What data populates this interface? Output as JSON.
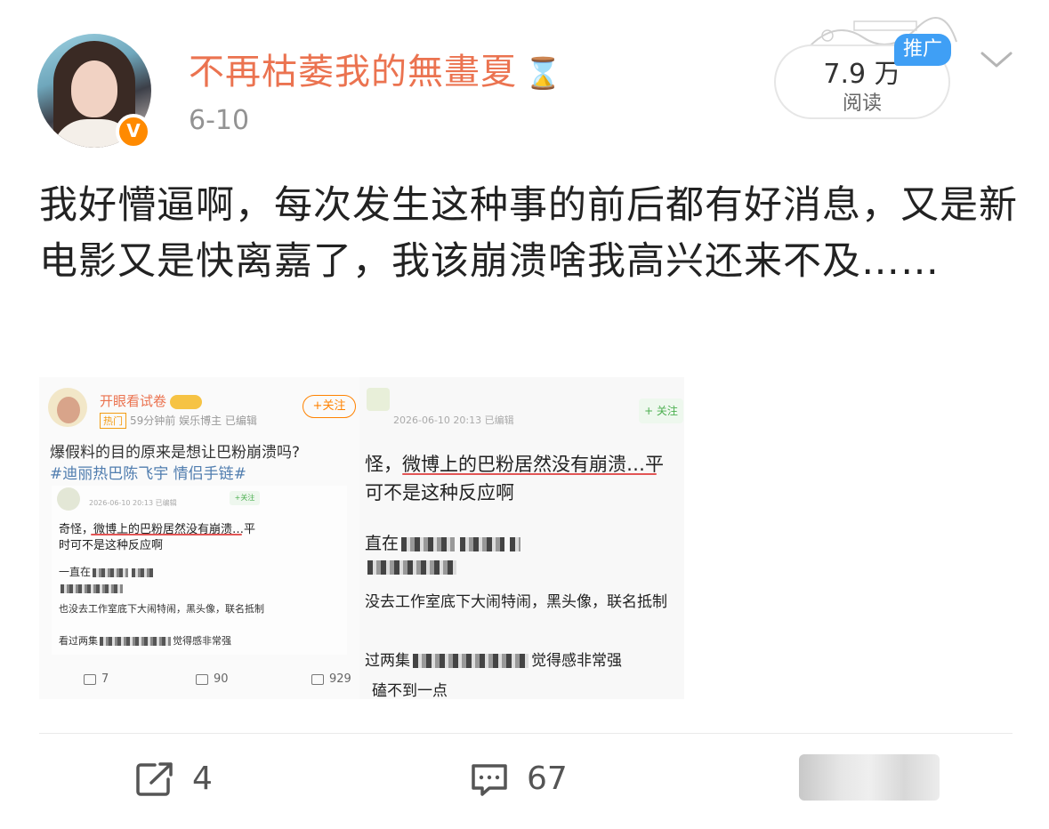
{
  "post": {
    "author": "不再枯萎我的無畫夏",
    "date": "6-10",
    "reads_value": "7.9 万",
    "reads_label": "阅读",
    "promo_label": "推广",
    "text": "我好懵逼啊，每次发生这种事的前后都有好消息，又是新电影又是快离嘉了，我该崩溃啥我高兴还来不及……"
  },
  "attachment": {
    "left_screenshot": {
      "name": "开眼看试卷",
      "hot_label": "热门",
      "meta": "59分钟前  娱乐博主  已编辑",
      "follow": "+关注",
      "title": "爆假料的目的原来是想让巴粉崩溃吗?",
      "hashtag": "#迪丽热巴陈飞宇 情侣手链#",
      "inner_date": "2026-06-10 20:13  已编辑",
      "inner_follow": "+关注",
      "line1": "奇怪，微博上的巴粉居然没有崩溃…平",
      "line2": "时可不是这种反应啊",
      "line3": "一直在",
      "line5": "也没去工作室底下大闹特闹，黑头像，联名抵制",
      "line6a": "看过两集",
      "line6b": "觉得感非常强",
      "repost_count": "7",
      "comment_count": "90",
      "like_count": "929"
    },
    "right_screenshot": {
      "date": "2026-06-10 20:13  已编辑",
      "follow": "+ 关注",
      "line1": "怪，微博上的巴粉居然没有崩溃…平",
      "line2": "可不是这种反应啊",
      "line3": "直在",
      "line5": "没去工作室底下大闹特闹，黑头像，联名抵制",
      "line6a": "过两集",
      "line6b": "觉得感非常强",
      "line7": "磕不到一点"
    }
  },
  "actions": {
    "repost_count": "4",
    "comment_count": "67"
  },
  "colors": {
    "username": "#eb7350",
    "verified_badge": "#ff8a00",
    "promo_badge": "#3f9ff5",
    "hashtag": "#507daf"
  },
  "icons": [
    "verified-v-icon",
    "hourglass-icon",
    "chevron-down-icon",
    "repost-icon",
    "comment-icon"
  ]
}
